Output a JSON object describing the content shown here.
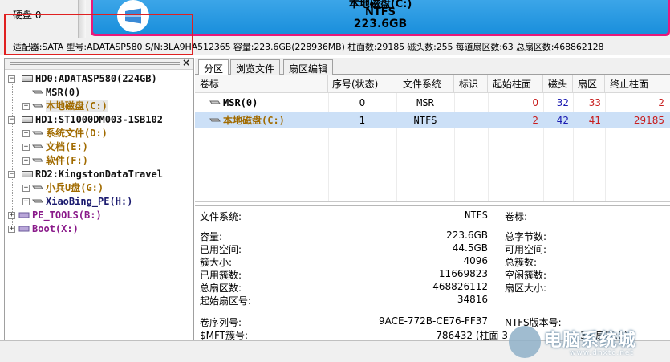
{
  "topbar": {
    "disk_label": "硬盘 0",
    "partition": {
      "name": "本地磁盘(C:)",
      "fs": "NTFS",
      "size": "223.6GB",
      "border_color": "#e8197a",
      "fill_color": "#2b9ee6"
    }
  },
  "info_line": "适配器:SATA  型号:ADATASP580  S/N:3LA9HA512365  容量:223.6GB(228936MB)  柱面数:29185  磁头数:255  每道扇区数:63  总扇区数:468862128",
  "tree": {
    "close_label": "×",
    "nodes": [
      {
        "label": "HD0:ADATASP580(224GB)",
        "kind": "disk",
        "color": "black"
      },
      {
        "label": "MSR(0)",
        "kind": "partition",
        "color": "black"
      },
      {
        "label": "本地磁盘(C:)",
        "kind": "partition",
        "color": "olive",
        "selected": true
      },
      {
        "label": "HD1:ST1000DM003-1SB102",
        "kind": "disk",
        "color": "black"
      },
      {
        "label": "系统文件(D:)",
        "kind": "partition",
        "color": "olive"
      },
      {
        "label": "文档(E:)",
        "kind": "partition",
        "color": "olive"
      },
      {
        "label": "软件(F:)",
        "kind": "partition",
        "color": "olive"
      },
      {
        "label": "RD2:KingstonDataTravel",
        "kind": "disk",
        "color": "black"
      },
      {
        "label": "小兵U盘(G:)",
        "kind": "partition",
        "color": "olive"
      },
      {
        "label": "XiaoBing_PE(H:)",
        "kind": "partition",
        "color": "navy"
      },
      {
        "label": "PE_TOOLS(B:)",
        "kind": "virtual",
        "color": "purple"
      },
      {
        "label": "Boot(X:)",
        "kind": "virtual",
        "color": "purple"
      }
    ]
  },
  "tabs": [
    "分区",
    "浏览文件",
    "扇区编辑"
  ],
  "table": {
    "headers": [
      "卷标",
      "序号(状态)",
      "文件系统",
      "标识",
      "起始柱面",
      "磁头",
      "扇区",
      "终止柱面"
    ],
    "rows": [
      {
        "label": "MSR(0)",
        "index": "0",
        "fs": "MSR",
        "id": "",
        "start_cyl": "0",
        "head": "32",
        "sector": "33",
        "end_cyl": "2"
      },
      {
        "label": "本地磁盘(C:)",
        "index": "1",
        "fs": "NTFS",
        "id": "",
        "start_cyl": "2",
        "head": "42",
        "sector": "41",
        "end_cyl": "29185"
      }
    ]
  },
  "details": {
    "fs_label": "文件系统:",
    "fs_value": "NTFS",
    "vol_label": "卷标:",
    "capacity_label": "容量:",
    "capacity_value": "223.6GB",
    "used_label": "已用空间:",
    "used_value": "44.5GB",
    "cluster_size_label": "簇大小:",
    "cluster_size_value": "4096",
    "used_clusters_label": "已用簇数:",
    "used_clusters_value": "11669823",
    "total_sectors_label": "总扇区数:",
    "total_sectors_value": "468826112",
    "start_sector_label": "起始扇区号:",
    "start_sector_value": "34816",
    "total_bytes_label": "总字节数:",
    "free_space_label": "可用空间:",
    "total_clusters_label": "总簇数:",
    "free_clusters_label": "空闲簇数:",
    "sector_size_label": "扇区大小:",
    "serial_label": "卷序列号:",
    "serial_value": "9ACE-772B-CE76-FF37",
    "ntfs_ver_label": "NTFS版本号:",
    "mft_label": "$MFT簇号:",
    "mft_value": "786432 (柱面 3",
    "mft_tail": "32 扇区:2)"
  },
  "watermark": {
    "text": "电脑系统城",
    "url": "www.dnxtc.net"
  }
}
